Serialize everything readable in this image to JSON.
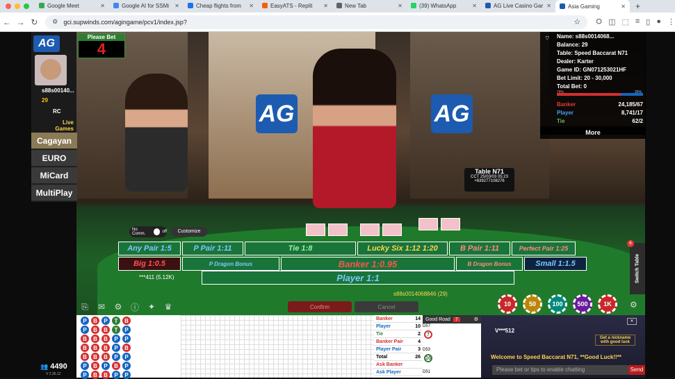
{
  "browser": {
    "tabs": [
      {
        "label": "Google Meet",
        "color": "#34a853"
      },
      {
        "label": "Google AI for SSMi",
        "color": "#4285f4"
      },
      {
        "label": "Cheap flights from",
        "color": "#1a73e8"
      },
      {
        "label": "EasyATS - Replit",
        "color": "#f26207"
      },
      {
        "label": "New Tab",
        "color": "#5f6368"
      },
      {
        "label": "(39) WhatsApp",
        "color": "#25d366"
      },
      {
        "label": "AG Live Casino Gar",
        "color": "#1c5bb0"
      },
      {
        "label": "Asia Gaming",
        "color": "#1c5bb0"
      }
    ],
    "url": "gci.supwinds.com/agingame/pcv1/index.jsp?"
  },
  "player": {
    "username": "s88s00140...",
    "balance": "29",
    "rc": "RC",
    "live_games": "Live Games"
  },
  "rooms": [
    "Cagayan",
    "EURO",
    "MiCard",
    "MultiPlay"
  ],
  "countdown": {
    "label": "Please Bet",
    "value": "4"
  },
  "info": {
    "name": "Name: s88s0014068...",
    "balance": "Balance: 29",
    "table": "Table: Speed Baccarat N71",
    "dealer": "Dealer: Karter",
    "game_id": "Game ID: GN071253021HF",
    "bet_limit": "Bet Limit: 20 - 30,000",
    "total_bet": "Total Bet: 0",
    "banker_pct": "74%",
    "player_pct": "26%",
    "banker_label": "Banker",
    "banker_value": "24,185/67",
    "player_label": "Player",
    "player_value": "8,741/17",
    "tie_label": "Tie",
    "tie_value": "62/2",
    "more": "More"
  },
  "table_sign": {
    "name": "Table N71",
    "time": "CCT 25/03/03 05:23",
    "phone": "+639277108276"
  },
  "bets": {
    "any_pair": "Any Pair 1:5",
    "p_pair": "P Pair 1:11",
    "tie": "Tie 1:8",
    "lucky_six": "Lucky Six 1:12 1:20",
    "b_pair": "B Pair 1:11",
    "perfect_pair": "Perfect Pair 1:25",
    "big": "Big 1:0.5",
    "p_dragon": "P Dragon Bonus",
    "banker": "Banker 1:0.95",
    "b_dragon": "B Dragon Bonus",
    "small": "Small 1:1.5",
    "player": "Player 1:1"
  },
  "controls": {
    "no_comm": "No Comm.",
    "off": "off",
    "customize": "Customize",
    "confirm": "Confirm",
    "cancel": "Cancel",
    "switch_table": "Switch Table",
    "badge": "6"
  },
  "table_players": {
    "left": "***411 (5.12K)",
    "right": "s88s0014068846 (29)"
  },
  "chips": [
    "10",
    "50",
    "100",
    "500",
    "1K"
  ],
  "stats": [
    {
      "label": "Banker",
      "value": "14",
      "color": "#d32f2f"
    },
    {
      "label": "Player",
      "value": "10",
      "color": "#1565c0"
    },
    {
      "label": "Tie",
      "value": "2",
      "color": "#2e7d32"
    },
    {
      "label": "Banker Pair",
      "value": "4",
      "color": "#d32f2f"
    },
    {
      "label": "Player Pair",
      "value": "3",
      "color": "#1565c0"
    },
    {
      "label": "Total",
      "value": "26",
      "color": "#000"
    },
    {
      "label": "Ask Banker",
      "value": "",
      "color": "#d32f2f"
    },
    {
      "label": "Ask Player",
      "value": "",
      "color": "#1565c0"
    }
  ],
  "good_road": {
    "label": "Good Road",
    "count": "7",
    "tables": [
      "D57",
      "D53",
      "D51"
    ],
    "numbers": [
      "7",
      "16"
    ]
  },
  "chat": {
    "user": "V***512",
    "welcome": "Welcome to Speed Baccarat N71, **Good Luck!!**",
    "nickname": "Get a nickname with good luck",
    "placeholder": "Please bet or tips to enable chatting",
    "send": "Send"
  },
  "footer": {
    "balance": "4490",
    "version": "V 2.36.12"
  },
  "bead_road": [
    [
      "P",
      "B",
      "P",
      "T",
      "B"
    ],
    [
      "P",
      "B",
      "B",
      "T",
      "P"
    ],
    [
      "B",
      "B",
      "B",
      "P",
      "P"
    ],
    [
      "B",
      "B",
      "B",
      "P",
      "B"
    ],
    [
      "B",
      "B",
      "B",
      "P",
      "P"
    ],
    [
      "P",
      "B",
      "P",
      "B",
      "P"
    ],
    [
      "P",
      "B",
      "B",
      "P",
      "P"
    ]
  ],
  "colors": {
    "banker": "#d32f2f",
    "player": "#1565c0",
    "tie": "#2e7d32"
  }
}
